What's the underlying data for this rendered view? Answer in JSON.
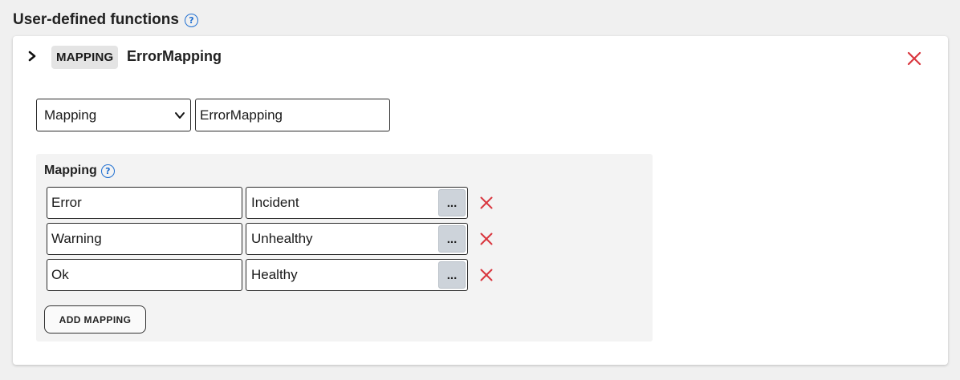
{
  "section": {
    "title": "User-defined functions",
    "help_glyph": "?"
  },
  "function_card": {
    "type_badge": "MAPPING",
    "name": "ErrorMapping",
    "close_icon": "close-x-icon",
    "type_select_value": "Mapping",
    "name_input_value": "ErrorMapping"
  },
  "mapping": {
    "title": "Mapping",
    "help_glyph": "?",
    "rows": [
      {
        "key": "Error",
        "value": "Incident",
        "more_label": "..."
      },
      {
        "key": "Warning",
        "value": "Unhealthy",
        "more_label": "..."
      },
      {
        "key": "Ok",
        "value": "Healthy",
        "more_label": "..."
      }
    ],
    "add_button_label": "ADD MAPPING"
  },
  "colors": {
    "accent_blue": "#1f6fd1",
    "remove_red": "#d9363e",
    "panel_gray": "#f3f3f3",
    "badge_gray": "#e4e4e4"
  }
}
